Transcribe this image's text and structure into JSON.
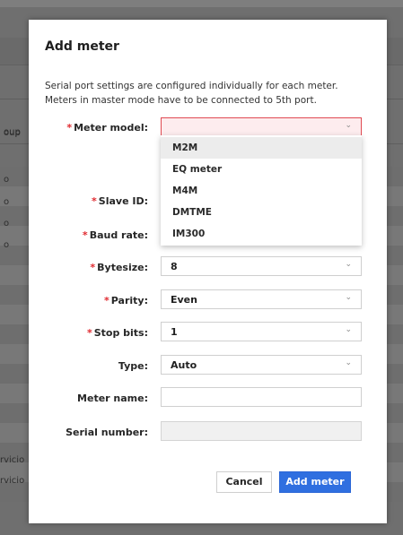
{
  "background": {
    "header_text": "oup",
    "row_texts": [
      "o",
      "o",
      "o",
      "o",
      "rvicio",
      "rvicio"
    ]
  },
  "modal": {
    "title": "Add meter",
    "description": "Serial port settings are configured individually for each meter. Meters in master mode have to be connected to 5th port.",
    "required_marker": "*",
    "fields": {
      "meter_model": {
        "label": "Meter model:",
        "value": "",
        "required": true,
        "state": "error-open"
      },
      "slave_id": {
        "label": "Slave ID:",
        "required": true
      },
      "baud_rate": {
        "label": "Baud rate:",
        "required": true
      },
      "bytesize": {
        "label": "Bytesize:",
        "value": "8",
        "required": true
      },
      "parity": {
        "label": "Parity:",
        "value": "Even",
        "required": true
      },
      "stop_bits": {
        "label": "Stop bits:",
        "value": "1",
        "required": true
      },
      "type": {
        "label": "Type:",
        "value": "Auto",
        "required": false
      },
      "meter_name": {
        "label": "Meter name:",
        "value": "",
        "required": false
      },
      "serial_number": {
        "label": "Serial number:",
        "value": "",
        "required": false,
        "disabled": true
      }
    },
    "dropdown_options": [
      "M2M",
      "EQ meter",
      "M4M",
      "DMTME",
      "IM300"
    ],
    "dropdown_highlighted": "M2M",
    "buttons": {
      "cancel": "Cancel",
      "add": "Add meter"
    },
    "colors": {
      "primary": "#2f6fe0",
      "error_border": "#e04a52",
      "error_bg": "#fdecee",
      "required": "#e0292f"
    },
    "chevron_glyph": "⌄"
  }
}
